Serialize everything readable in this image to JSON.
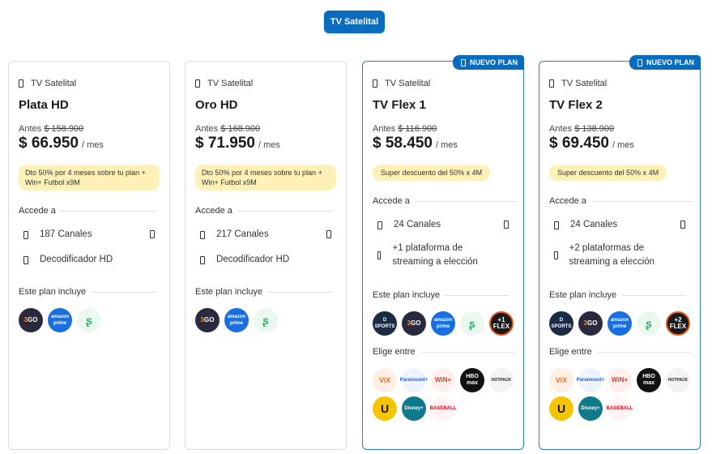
{
  "top_tab": {
    "label": "TV Satelital"
  },
  "cards": [
    {
      "badge": "",
      "category": "TV Satelital",
      "name": "Plata HD",
      "antes_label": "Antes",
      "old_price": "$ 158.900",
      "price": "$ 66.950",
      "per": "/ mes",
      "promo": "Dto 50% por 4 meses sobre tu plan + Win+ Futbol x9M",
      "access_label": "Accede a",
      "features": [
        "187 Canales",
        "Decodificador HD"
      ],
      "includes_label": "Este plan incluye",
      "includes": [
        "dgo-icon",
        "amazon-prime-icon",
        "green-app-icon"
      ],
      "choose_label": "",
      "choose": []
    },
    {
      "badge": "",
      "category": "TV Satelital",
      "name": "Oro HD",
      "antes_label": "Antes",
      "old_price": "$ 168.900",
      "price": "$ 71.950",
      "per": "/ mes",
      "promo": "Dto 50% por 4 meses sobre tu plan + Win+ Futbol x9M",
      "access_label": "Accede a",
      "features": [
        "217 Canales",
        "Decodificador HD"
      ],
      "includes_label": "Este plan incluye",
      "includes": [
        "dgo-icon",
        "amazon-prime-icon",
        "green-app-icon"
      ],
      "choose_label": "",
      "choose": []
    },
    {
      "badge": "NUEVO PLAN",
      "category": "TV Satelital",
      "name": "TV Flex 1",
      "antes_label": "Antes",
      "old_price": "$ 116.900",
      "price": "$ 58.450",
      "per": "/ mes",
      "promo": "Super descuento del 50% x 4M",
      "access_label": "Accede a",
      "features": [
        "24 Canales",
        "+1 plataforma de streaming a elección"
      ],
      "includes_label": "Este plan incluye",
      "includes": [
        "dsports-icon",
        "dgo-icon",
        "amazon-prime-icon",
        "green-app-icon",
        "flex-1-icon"
      ],
      "choose_label": "Elige entre",
      "choose": [
        "vix-icon",
        "paramount-icon",
        "win-plus-icon",
        "hbo-max-icon",
        "hotpack-icon",
        "universal-icon",
        "disney-plus-icon",
        "baseball-icon"
      ]
    },
    {
      "badge": "NUEVO PLAN",
      "category": "TV Satelital",
      "name": "TV Flex 2",
      "antes_label": "Antes",
      "old_price": "$ 138.900",
      "price": "$ 69.450",
      "per": "/ mes",
      "promo": "Super descuento del 50% x 4M",
      "access_label": "Accede a",
      "features": [
        "24 Canales",
        "+2 plataformas de streaming a elección"
      ],
      "includes_label": "Este plan incluye",
      "includes": [
        "dsports-icon",
        "dgo-icon",
        "amazon-prime-icon",
        "green-app-icon",
        "flex-2-icon"
      ],
      "choose_label": "Elige entre",
      "choose": [
        "vix-icon",
        "paramount-icon",
        "win-plus-icon",
        "hbo-max-icon",
        "hotpack-icon",
        "universal-icon",
        "disney-plus-icon",
        "baseball-icon"
      ]
    }
  ]
}
